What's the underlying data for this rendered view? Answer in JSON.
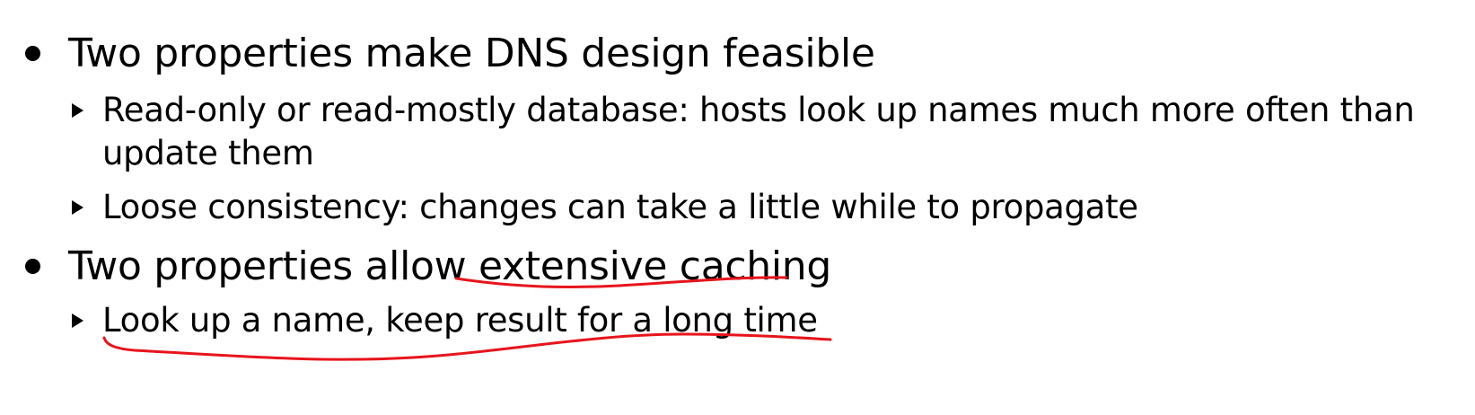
{
  "bullets": [
    {
      "text": "Two properties make DNS design feasible",
      "sub": [
        {
          "line1": "Read-only or read-mostly database: hosts look up names much more often than",
          "line2": "update them"
        },
        {
          "line1": "Loose consistency: changes can take a little while to propagate"
        }
      ]
    },
    {
      "text": "Two properties allow extensive caching",
      "sub": [
        {
          "line1": "Look up a name, keep result for a long time"
        }
      ]
    }
  ],
  "annotation": {
    "color": "#e8141c",
    "kind": "handwritten underline",
    "underlined": [
      "extensive caching",
      "Look up a name, keep result for a long time"
    ]
  }
}
